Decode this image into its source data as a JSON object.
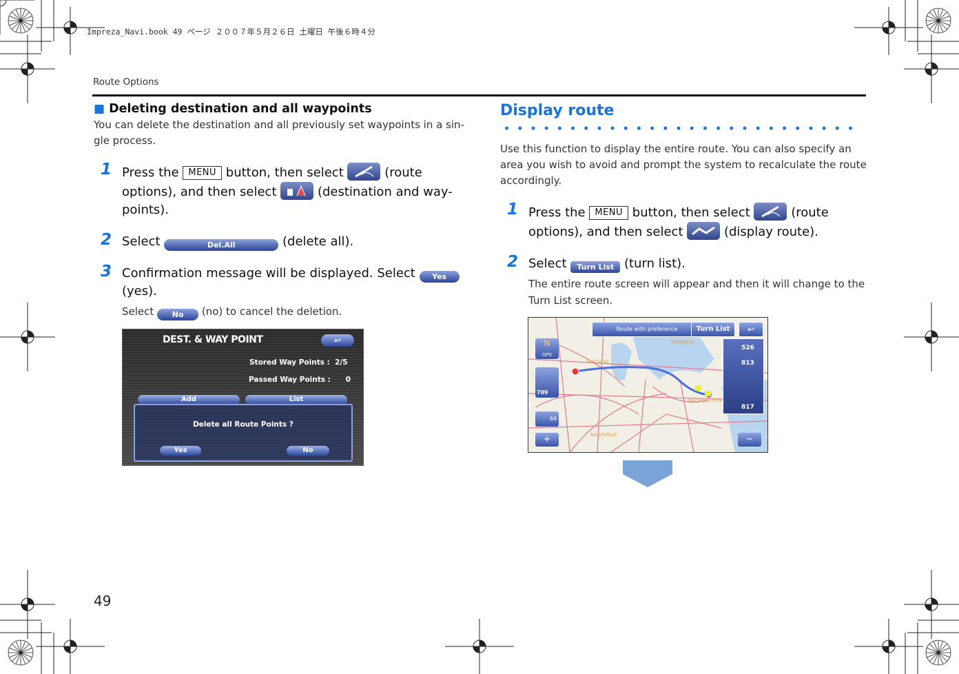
{
  "header": {
    "meta": "Impreza_Navi.book  49 ページ  ２００７年５月２６日  土曜日  午後６時４分",
    "section": "Route Options"
  },
  "left": {
    "subhead": "Deleting destination and all waypoints",
    "intro": "You can delete the destination and all previously set waypoints in a sin-gle process.",
    "step1": {
      "num": "1",
      "a": "Press the",
      "menu": "MENU",
      "b": "button, then select",
      "c": "(route options), and then select",
      "d": "(destination and way-points)."
    },
    "step2": {
      "num": "2",
      "a": "Select",
      "btn": "Del.All",
      "b": "(delete all)."
    },
    "step3": {
      "num": "3",
      "a": "Confirmation message will be displayed. Select",
      "btn": "Yes",
      "b": "(yes)."
    },
    "note": {
      "a": "Select",
      "btn": "No",
      "b": "(no) to cancel the deletion."
    },
    "screen": {
      "title": "DEST. & WAY POINT",
      "stored": "Stored Way Points :  2/5",
      "passed": "Passed Way Points :      0",
      "add": "Add",
      "list": "List",
      "dialog": "Delete all Route Points ?",
      "yes": "Yes",
      "no": "No"
    }
  },
  "right": {
    "title": "Display route",
    "intro": "Use this function to display the entire route. You can also specify an area you wish to avoid and prompt the system to recalculate the route accordingly.",
    "step1": {
      "num": "1",
      "a": "Press the",
      "menu": "MENU",
      "b": "button, then select",
      "c": "(route options), and then select",
      "d": "(display route)."
    },
    "step2": {
      "num": "2",
      "a": "Select",
      "btn": "Turn List",
      "b": "(turn list)."
    },
    "note": "The entire route screen will appear and then it will change to the Turn List screen.",
    "map": {
      "banner": "Route with preference",
      "turnlist": "Turn List",
      "gps": "GPS",
      "d1": "526",
      "d2": "813",
      "d3": "817",
      "d4": "709",
      "d5": "64",
      "c1": "TORONTO",
      "c2": "CHICAGO",
      "c3": "WASHINGTON",
      "c4": "NASHVILLE"
    }
  },
  "page_number": "49"
}
